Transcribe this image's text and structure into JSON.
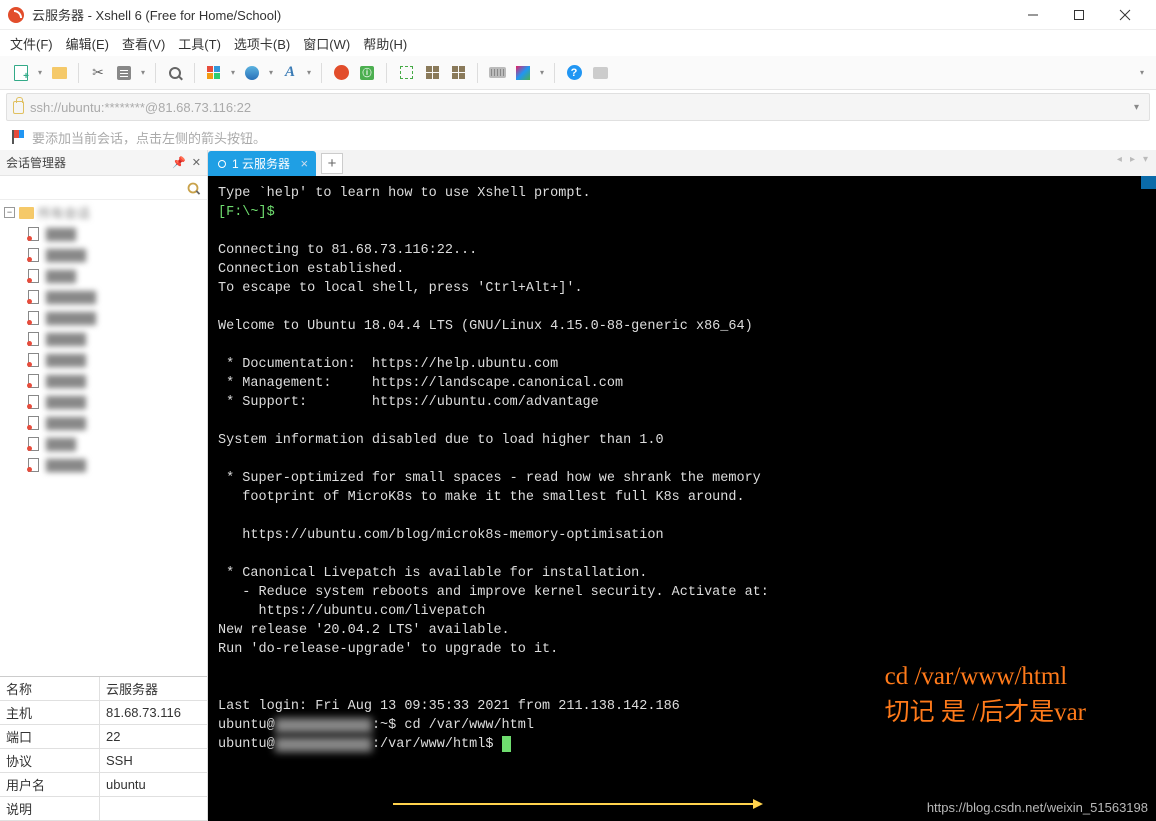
{
  "titlebar": {
    "title": "云服务器 - Xshell 6 (Free for Home/School)"
  },
  "menubar": [
    "文件(F)",
    "编辑(E)",
    "查看(V)",
    "工具(T)",
    "选项卡(B)",
    "窗口(W)",
    "帮助(H)"
  ],
  "address": {
    "url": "ssh://ubuntu:********@81.68.73.116:22"
  },
  "hint": "要添加当前会话，点击左侧的箭头按钮。",
  "sidebar": {
    "title": "会话管理器",
    "root": "所有会话",
    "items": [
      "▇▇▇",
      "▇▇▇▇",
      "▇▇▇",
      "▇▇▇▇▇",
      "▇▇▇▇▇",
      "▇▇▇▇",
      "▇▇▇▇",
      "▇▇▇▇",
      "▇▇▇▇",
      "▇▇▇▇",
      "▇▇▇",
      "▇▇▇▇"
    ]
  },
  "props": {
    "headK": "名称",
    "headV": "云服务器",
    "rows": [
      {
        "k": "主机",
        "v": "81.68.73.116"
      },
      {
        "k": "端口",
        "v": "22"
      },
      {
        "k": "协议",
        "v": "SSH"
      },
      {
        "k": "用户名",
        "v": "ubuntu"
      },
      {
        "k": "说明",
        "v": ""
      }
    ]
  },
  "tab": {
    "index": "1",
    "label": "云服务器"
  },
  "terminal": {
    "l1": "Type `help' to learn how to use Xshell prompt.",
    "l2": "[F:\\~]$",
    "l3": "Connecting to 81.68.73.116:22...",
    "l4": "Connection established.",
    "l5": "To escape to local shell, press 'Ctrl+Alt+]'.",
    "l6": "Welcome to Ubuntu 18.04.4 LTS (GNU/Linux 4.15.0-88-generic x86_64)",
    "l7": " * Documentation:  https://help.ubuntu.com",
    "l8": " * Management:     https://landscape.canonical.com",
    "l9": " * Support:        https://ubuntu.com/advantage",
    "l10": "System information disabled due to load higher than 1.0",
    "l11": " * Super-optimized for small spaces - read how we shrank the memory",
    "l12": "   footprint of MicroK8s to make it the smallest full K8s around.",
    "l13": "   https://ubuntu.com/blog/microk8s-memory-optimisation",
    "l14": " * Canonical Livepatch is available for installation.",
    "l15": "   - Reduce system reboots and improve kernel security. Activate at:",
    "l16": "     https://ubuntu.com/livepatch",
    "l17": "New release '20.04.2 LTS' available.",
    "l18": "Run 'do-release-upgrade' to upgrade to it.",
    "l19": "Last login: Fri Aug 13 09:35:33 2021 from 211.138.142.186",
    "p1a": "ubuntu@",
    "p1b": ":~$ cd /var/www/html",
    "p2a": "ubuntu@",
    "p2b": ":/var/www/html$ "
  },
  "annotation": {
    "line1": "cd /var/www/html",
    "line2": "切记 是 /后才是var"
  },
  "watermark": "https://blog.csdn.net/weixin_51563198"
}
